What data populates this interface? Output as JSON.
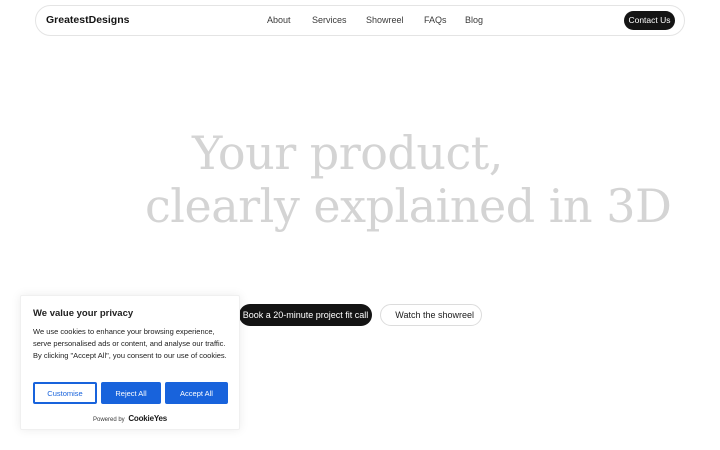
{
  "nav": {
    "brand": "GreatestDesigns",
    "links": [
      "About",
      "Services",
      "Showreel",
      "FAQs",
      "Blog"
    ],
    "contact_label": "Contact Us"
  },
  "hero": {
    "line1": "Your product,",
    "line2": "clearly explained in 3D",
    "primary_cta": "Book a 20-minute project fit call",
    "secondary_cta": "Watch the showreel"
  },
  "cookie": {
    "title": "We value your privacy",
    "body": "We use cookies to enhance your browsing experience, serve personalised ads or content, and analyse our traffic. By clicking \"Accept All\", you consent to our use of cookies.",
    "customise_label": "Customise",
    "reject_label": "Reject All",
    "accept_label": "Accept All",
    "powered_by": "Powered by",
    "powered_brand": "CookieYes"
  },
  "colors": {
    "accent": "#1863dc",
    "dark": "#141414",
    "hero_text": "#d4d4d4"
  }
}
